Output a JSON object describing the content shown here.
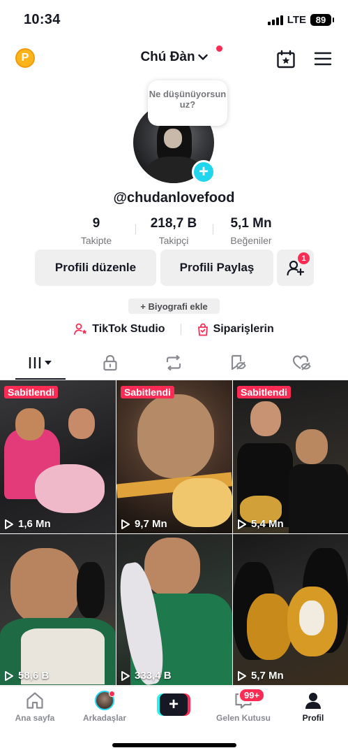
{
  "status_bar": {
    "time": "10:34",
    "network": "LTE",
    "battery": "89"
  },
  "header": {
    "coin_label": "P",
    "username": "Chú Đàn"
  },
  "profile": {
    "bubble_text": "Ne düşünüyorsun uz?",
    "handle": "@chudanlovefood",
    "stats": [
      {
        "value": "9",
        "label": "Takipte"
      },
      {
        "value": "218,7 B",
        "label": "Takipçi"
      },
      {
        "value": "5,1 Mn",
        "label": "Beğeniler"
      }
    ],
    "edit_button": "Profili düzenle",
    "share_button": "Profili Paylaş",
    "friend_request_count": "1",
    "bio_button": "+ Biyografi ekle",
    "links": {
      "studio": "TikTok Studio",
      "orders": "Siparişlerin"
    }
  },
  "tabs": [
    "videos-tab",
    "private-tab",
    "reposts-tab",
    "favorites-tab",
    "liked-tab"
  ],
  "videos": [
    {
      "pinned": "Sabitlendi",
      "views": "1,6 Mn"
    },
    {
      "pinned": "Sabitlendi",
      "views": "9,7 Mn"
    },
    {
      "pinned": "Sabitlendi",
      "views": "5,4 Mn"
    },
    {
      "pinned": "",
      "views": "58,6 B"
    },
    {
      "pinned": "",
      "views": "333,4 B"
    },
    {
      "pinned": "",
      "views": "5,7 Mn"
    }
  ],
  "nav": {
    "home": "Ana sayfa",
    "friends": "Arkadaşlar",
    "inbox": "Gelen Kutusu",
    "inbox_badge": "99+",
    "profile": "Profil"
  },
  "colors": {
    "accent": "#fe2c55",
    "cyan": "#20d5ec",
    "coin": "#fbb51b"
  }
}
